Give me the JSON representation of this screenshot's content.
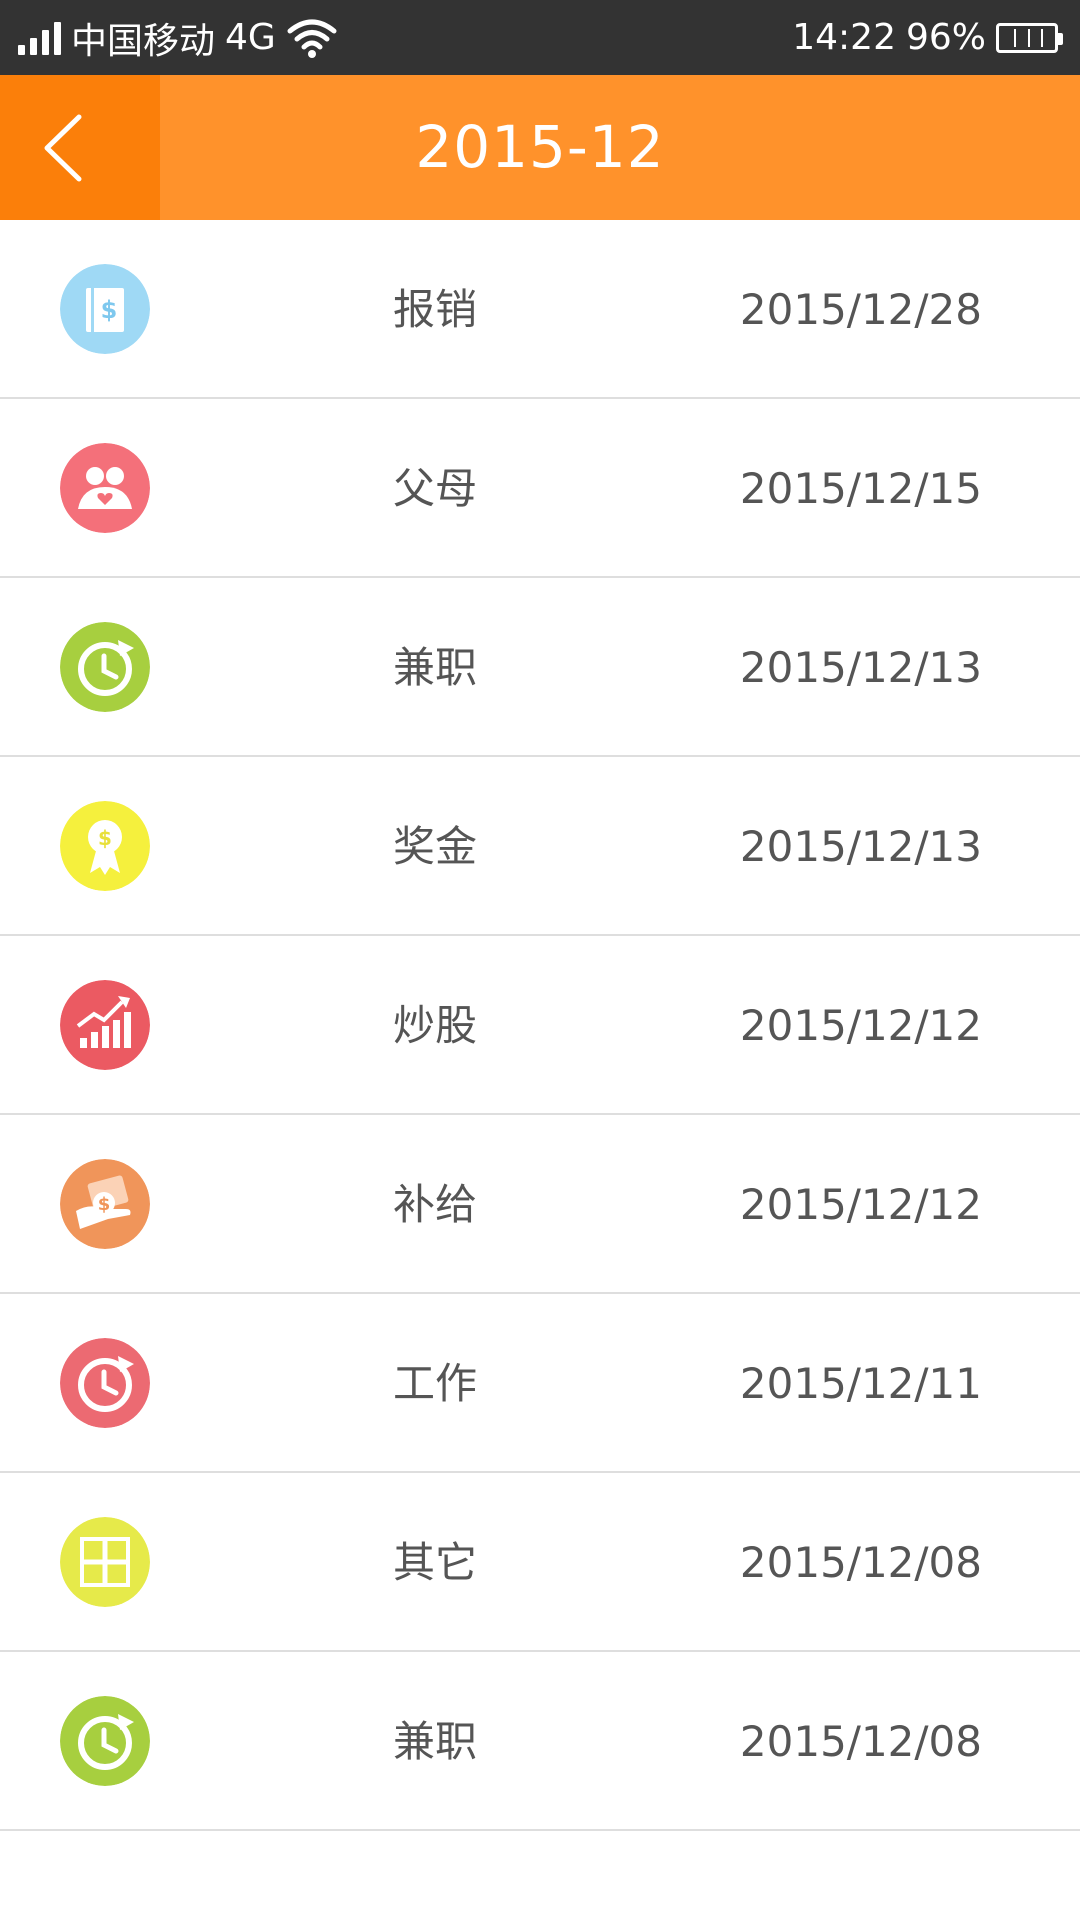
{
  "status_bar": {
    "carrier": "中国移动",
    "network": "4G",
    "time": "14:22",
    "battery": "96%"
  },
  "header": {
    "title": "2015-12",
    "back_icon": "chevron-left-icon",
    "accent_color": "#ff922b",
    "back_bg_color": "#fb7f0a"
  },
  "records": [
    {
      "category": "报销",
      "date": "2015/12/28",
      "icon": "reimbursement-icon",
      "color": "#9fd9f5"
    },
    {
      "category": "父母",
      "date": "2015/12/15",
      "icon": "parents-icon",
      "color": "#f4707a"
    },
    {
      "category": "兼职",
      "date": "2015/12/13",
      "icon": "part-time-clock-icon",
      "color": "#a7cf3f"
    },
    {
      "category": "奖金",
      "date": "2015/12/13",
      "icon": "bonus-medal-icon",
      "color": "#f5f03d"
    },
    {
      "category": "炒股",
      "date": "2015/12/12",
      "icon": "stock-chart-icon",
      "color": "#eb5a62"
    },
    {
      "category": "补给",
      "date": "2015/12/12",
      "icon": "allowance-icon",
      "color": "#f0955a"
    },
    {
      "category": "工作",
      "date": "2015/12/11",
      "icon": "work-clock-icon",
      "color": "#ec6a72"
    },
    {
      "category": "其它",
      "date": "2015/12/08",
      "icon": "other-grid-icon",
      "color": "#e6ea4a"
    },
    {
      "category": "兼职",
      "date": "2015/12/08",
      "icon": "part-time-clock-icon",
      "color": "#a7cf3f"
    }
  ]
}
